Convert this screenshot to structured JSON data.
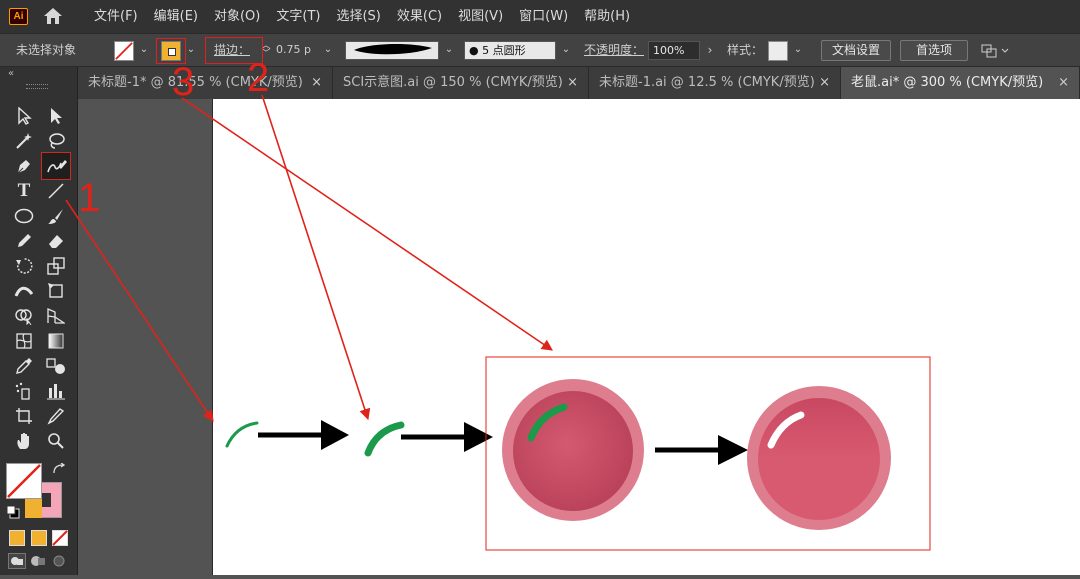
{
  "app": {
    "logo_text": "Ai"
  },
  "menu": [
    "文件(F)",
    "编辑(E)",
    "对象(O)",
    "文字(T)",
    "选择(S)",
    "效果(C)",
    "视图(V)",
    "窗口(W)",
    "帮助(H)"
  ],
  "control_bar": {
    "selection_label": "未选择对象",
    "stroke_label": "描边：",
    "stroke_weight": "0.75 p",
    "brush_label": "● 5 点圆形",
    "opacity_label": "不透明度：",
    "opacity_value": "100%",
    "style_label": "样式：",
    "doc_settings_button": "文档设置",
    "preferences_button": "首选项"
  },
  "tabs": [
    {
      "label": "未标题-1* @ 81.55 % (CMYK/预览)",
      "close": "×",
      "active": false
    },
    {
      "label": "SCI示意图.ai @ 150 % (CMYK/预览)",
      "close": "×",
      "active": false
    },
    {
      "label": "未标题-1.ai @ 12.5 % (CMYK/预览)",
      "close": "×",
      "active": false
    },
    {
      "label": "老鼠.ai* @ 300 % (CMYK/预览)",
      "close": "×",
      "active": true
    }
  ],
  "toolbar": {
    "collapse": "«",
    "tools": [
      "selection-tool",
      "direct-selection-tool",
      "magic-wand-tool",
      "lasso-tool",
      "pen-tool",
      "blob-brush-tool",
      "type-tool",
      "line-tool",
      "ellipse-tool",
      "paintbrush-tool",
      "pencil-tool",
      "eraser-tool",
      "rotate-tool",
      "scale-tool",
      "width-tool",
      "free-transform-tool",
      "shape-builder-tool",
      "perspective-grid-tool",
      "mesh-tool",
      "gradient-tool",
      "eyedropper-tool",
      "blend-tool",
      "symbol-sprayer-tool",
      "column-graph-tool",
      "artboard-tool",
      "slice-tool",
      "hand-tool",
      "zoom-tool"
    ]
  },
  "annotations": {
    "n1": "1",
    "n2": "2",
    "n3": "3"
  },
  "colors": {
    "accent_red": "#e0231a",
    "green_stroke": "#1a9a4a",
    "ball_dark": "#c44a60",
    "ball_light": "#e07a8a",
    "fill_orange": "#f0b030",
    "stroke_pink": "#f4a6b8"
  }
}
